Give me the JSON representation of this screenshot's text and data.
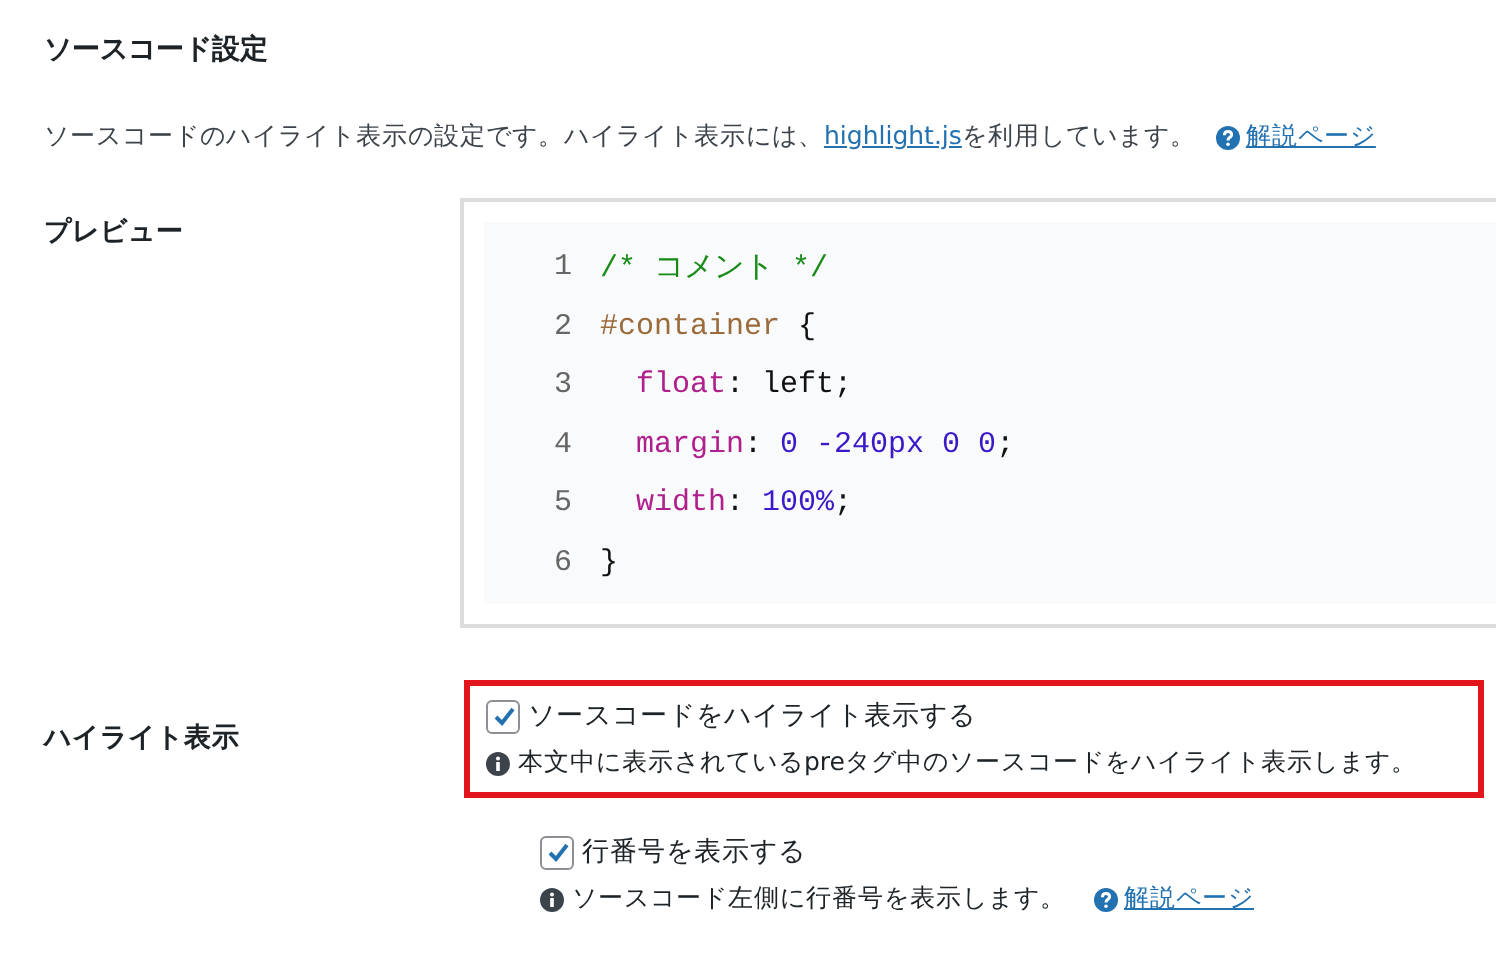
{
  "section": {
    "title": "ソースコード設定",
    "description_parts": [
      {
        "kind": "text",
        "text": "ソースコードのハイライト表示の設定です。ハイライト表示には、"
      },
      {
        "kind": "link",
        "text": "highlight.js"
      },
      {
        "kind": "text",
        "text": "を利用しています。"
      }
    ],
    "help_link": "解説ページ"
  },
  "preview": {
    "label": "プレビュー",
    "lines": [
      {
        "number": "1",
        "tokens": [
          {
            "kind": "comment",
            "text": "/* コメント */"
          }
        ]
      },
      {
        "number": "2",
        "tokens": [
          {
            "kind": "selector",
            "text": "#container"
          },
          {
            "kind": "plain",
            "text": " {"
          }
        ]
      },
      {
        "number": "3",
        "tokens": [
          {
            "kind": "property",
            "text": "  float"
          },
          {
            "kind": "plain",
            "text": ": left;"
          }
        ]
      },
      {
        "number": "4",
        "tokens": [
          {
            "kind": "property",
            "text": "  margin"
          },
          {
            "kind": "plain",
            "text": ": "
          },
          {
            "kind": "number",
            "text": "0 -240px 0 0"
          },
          {
            "kind": "plain",
            "text": ";"
          }
        ]
      },
      {
        "number": "5",
        "tokens": [
          {
            "kind": "property",
            "text": "  width"
          },
          {
            "kind": "plain",
            "text": ": "
          },
          {
            "kind": "number",
            "text": "100%"
          },
          {
            "kind": "plain",
            "text": ";"
          }
        ]
      },
      {
        "number": "6",
        "tokens": [
          {
            "kind": "plain",
            "text": "}"
          }
        ]
      }
    ]
  },
  "highlight": {
    "label": "ハイライト表示",
    "options": [
      {
        "label": "ソースコードをハイライト表示する",
        "checked": true,
        "nested": false,
        "highlighted": true,
        "note": "本文中に表示されているpreタグ中のソースコードをハイライト表示します。"
      },
      {
        "label": "行番号を表示する",
        "checked": true,
        "nested": true,
        "highlighted": false,
        "note": "ソースコード左側に行番号を表示します。",
        "help_link": "解説ページ"
      }
    ]
  }
}
